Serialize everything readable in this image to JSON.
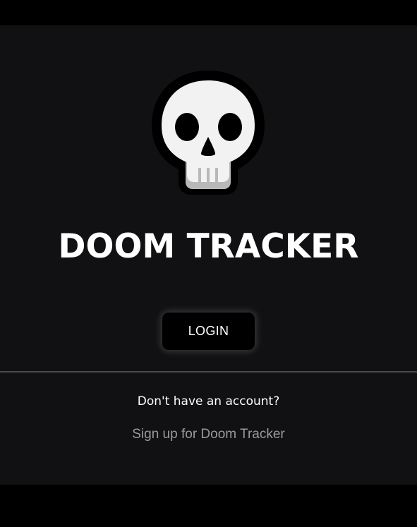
{
  "app": {
    "title": "DOOM TRACKER"
  },
  "logo": {
    "icon": "skull-icon"
  },
  "login": {
    "label": "LOGIN"
  },
  "signup": {
    "prompt": "Don't have an account?",
    "link_label": "Sign up for Doom Tracker"
  },
  "colors": {
    "page_background": "#000000",
    "card_background": "#111113",
    "text_primary": "#ffffff",
    "text_muted": "#9a9a9e",
    "divider": "#4a4a4c",
    "button_background": "#000000"
  }
}
